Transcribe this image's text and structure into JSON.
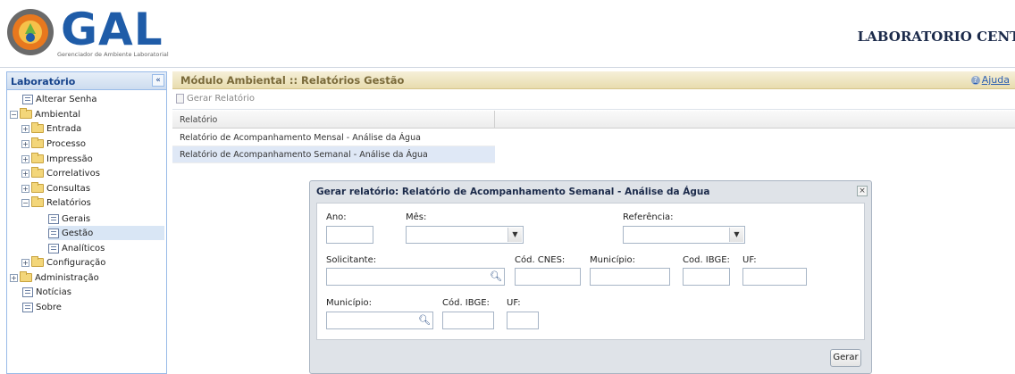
{
  "header": {
    "logo_text": "GAL",
    "logo_subtitle": "Gerenciador de Ambiente Laboratorial",
    "lab_title": "LABORATORIO CENTRAL"
  },
  "sidebar": {
    "title": "Laboratório",
    "collapse_icon": "«",
    "items": [
      {
        "label": "Alterar Senha"
      },
      {
        "label": "Ambiental"
      },
      {
        "label": "Entrada"
      },
      {
        "label": "Processo"
      },
      {
        "label": "Impressão"
      },
      {
        "label": "Correlativos"
      },
      {
        "label": "Consultas"
      },
      {
        "label": "Relatórios"
      },
      {
        "label": "Gerais"
      },
      {
        "label": "Gestão"
      },
      {
        "label": "Analíticos"
      },
      {
        "label": "Configuração"
      },
      {
        "label": "Administração"
      },
      {
        "label": "Notícias"
      },
      {
        "label": "Sobre"
      }
    ]
  },
  "main": {
    "title": "Módulo Ambiental :: Relatórios Gestão",
    "help_label": "Ajuda",
    "toolbar_gerar": "Gerar Relatório",
    "grid": {
      "column": "Relatório",
      "rows": [
        "Relatório de Acompanhamento Mensal - Análise da Água",
        "Relatório de Acompanhamento Semanal - Análise da Água"
      ]
    }
  },
  "dialog": {
    "title": "Gerar relatório: Relatório de Acompanhamento Semanal - Análise da Água",
    "close": "×",
    "labels": {
      "ano": "Ano:",
      "mes": "Mês:",
      "referencia": "Referência:",
      "solicitante": "Solicitante:",
      "cod_cnes": "Cód. CNES:",
      "municipio1": "Município:",
      "cod_ibge1": "Cod. IBGE:",
      "uf1": "UF:",
      "municipio2": "Município:",
      "cod_ibge2": "Cód. IBGE:",
      "uf2": "UF:"
    },
    "values": {
      "ano": "",
      "mes": "",
      "referencia": "",
      "solicitante": "",
      "cod_cnes": "",
      "municipio1": "",
      "cod_ibge1": "",
      "uf1": "",
      "municipio2": "",
      "cod_ibge2": "",
      "uf2": ""
    },
    "gerar_button": "Gerar"
  }
}
